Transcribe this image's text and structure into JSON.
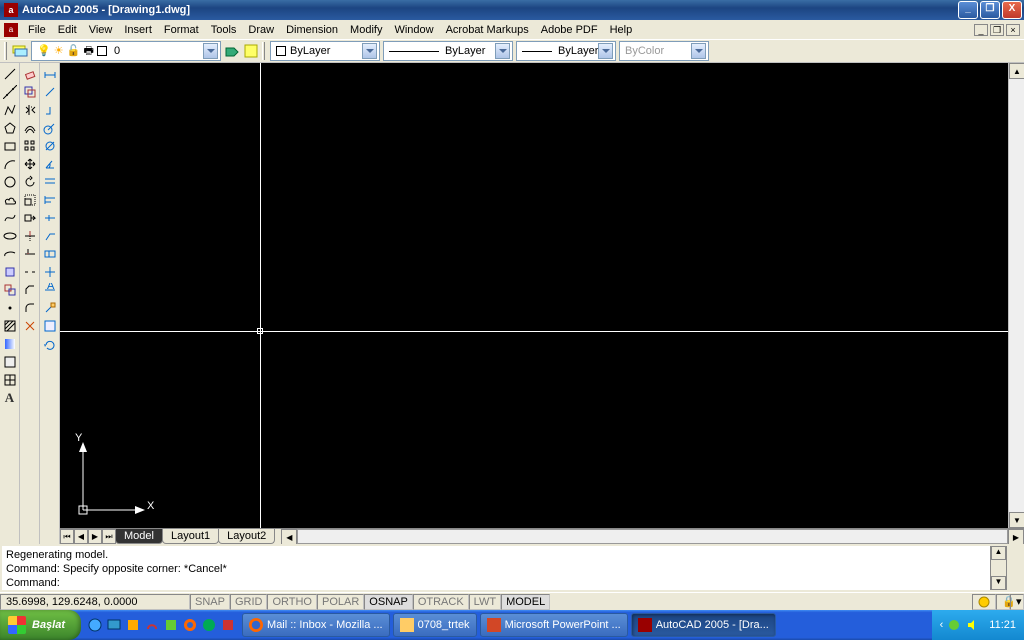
{
  "titlebar": {
    "title": "AutoCAD 2005 - [Drawing1.dwg]"
  },
  "menu": [
    "File",
    "Edit",
    "View",
    "Insert",
    "Format",
    "Tools",
    "Draw",
    "Dimension",
    "Modify",
    "Window",
    "Acrobat Markups",
    "Adobe PDF",
    "Help"
  ],
  "layer_toolbar": {
    "layer_dropdown": "0",
    "color_dropdown": "ByLayer",
    "linetype_dropdown": "ByLayer",
    "lineweight_dropdown": "ByLayer",
    "plotstyle_dropdown": "ByColor"
  },
  "tabs": {
    "model": "Model",
    "layout1": "Layout1",
    "layout2": "Layout2"
  },
  "command": {
    "line1": "Regenerating model.",
    "line2": "Command: Specify opposite corner: *Cancel*",
    "line3": "Command:"
  },
  "status": {
    "coords": "35.6998, 129.6248, 0.0000",
    "toggles": [
      "SNAP",
      "GRID",
      "ORTHO",
      "POLAR",
      "OSNAP",
      "OTRACK",
      "LWT",
      "MODEL"
    ]
  },
  "ucs": {
    "x": "X",
    "y": "Y"
  },
  "taskbar": {
    "start": "Başlat",
    "items": [
      {
        "label": "Mail :: Inbox - Mozilla ..."
      },
      {
        "label": "0708_trtek"
      },
      {
        "label": "Microsoft PowerPoint ..."
      },
      {
        "label": "AutoCAD 2005 - [Dra..."
      }
    ],
    "clock": "11:21"
  }
}
